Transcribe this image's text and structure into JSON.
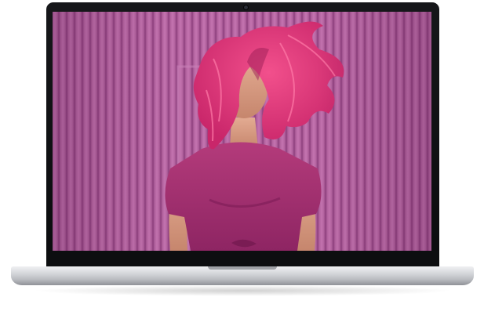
{
  "image": {
    "subject": "laptop-product-photo",
    "colors": {
      "bezel": "#0d0e10",
      "screen_background": "#b2629e",
      "hair": "#e23d7d",
      "shirt": "#a3306f",
      "skin": "#d9a088",
      "chassis": "#c9cbcf"
    }
  }
}
